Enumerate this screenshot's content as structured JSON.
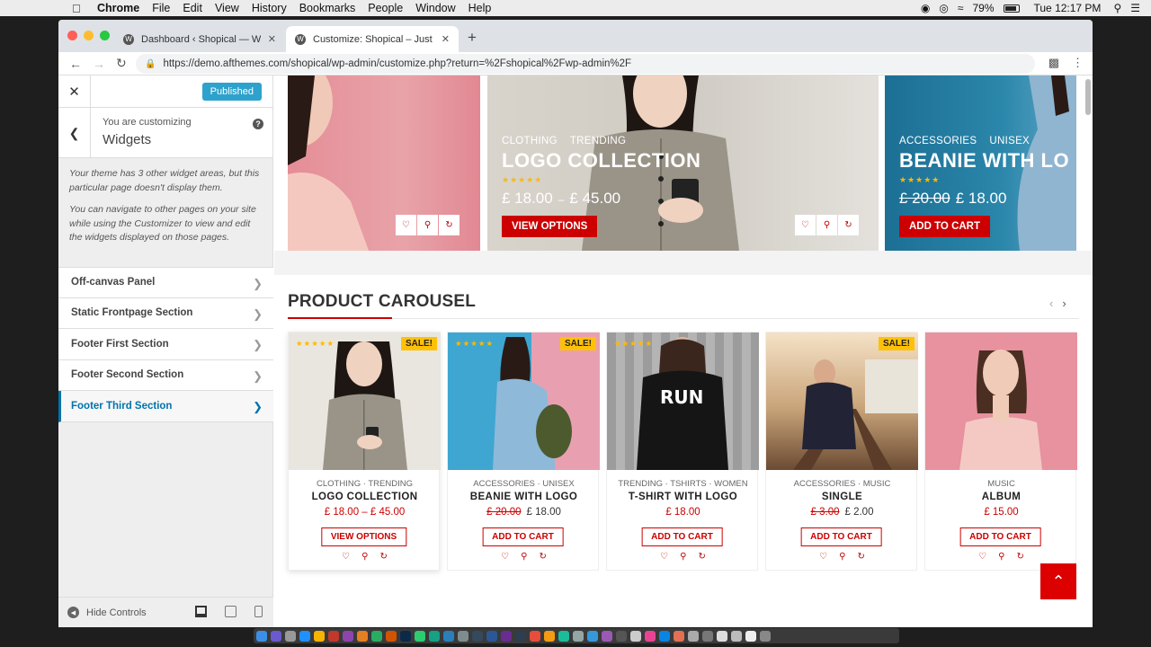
{
  "menubar": {
    "app": "Chrome",
    "items": [
      "File",
      "Edit",
      "View",
      "History",
      "Bookmarks",
      "People",
      "Window",
      "Help"
    ],
    "battery": "79%",
    "clock": "Tue 12:17 PM"
  },
  "browser": {
    "tabs": [
      {
        "title": "Dashboard ‹ Shopical — Wordi"
      },
      {
        "title": "Customize: Shopical – Just anc"
      }
    ],
    "url": "https://demo.afthemes.com/shopical/wp-admin/customize.php?return=%2Fshopical%2Fwp-admin%2F"
  },
  "panel": {
    "publish_label": "Published",
    "customizing_label": "You are customizing",
    "section_title": "Widgets",
    "notice_1": "Your theme has 3 other widget areas, but this particular page doesn't display them.",
    "notice_2": "You can navigate to other pages on your site while using the Customizer to view and edit the widgets displayed on those pages.",
    "sections": [
      {
        "label": "Off-canvas Panel"
      },
      {
        "label": "Static Frontpage Section"
      },
      {
        "label": "Footer First Section"
      },
      {
        "label": "Footer Second Section"
      },
      {
        "label": "Footer Third Section"
      }
    ],
    "hide_controls": "Hide Controls"
  },
  "hero": [
    {
      "cats": [
        "CLOTHING",
        "TRENDING"
      ],
      "title": "LOGO COLLECTION",
      "price_from": "£ 18.00",
      "price_to": "£ 45.00",
      "button": "VIEW OPTIONS"
    },
    {
      "cats": [
        "ACCESSORIES",
        "UNISEX"
      ],
      "title": "BEANIE WITH LO",
      "price_old": "£ 20.00",
      "price_new": "£ 18.00",
      "button": "ADD TO CART"
    }
  ],
  "carousel": {
    "title": "PRODUCT CAROUSEL",
    "sale_label": "SALE!",
    "products": [
      {
        "cats": "CLOTHING · TRENDING",
        "name": "LOGO COLLECTION",
        "price_a": "£ 18.00 – £ 45.00",
        "button": "VIEW OPTIONS"
      },
      {
        "cats": "ACCESSORIES · UNISEX",
        "name": "BEANIE WITH LOGO",
        "price_old": "£ 20.00",
        "price_new": "£ 18.00",
        "button": "ADD TO CART"
      },
      {
        "cats": "TRENDING · TSHIRTS · WOMEN",
        "name": "T-SHIRT WITH LOGO",
        "price_a": "£ 18.00",
        "button": "ADD TO CART",
        "img_text": "RUN"
      },
      {
        "cats": "ACCESSORIES · MUSIC",
        "name": "SINGLE",
        "price_old": "£ 3.00",
        "price_new": "£ 2.00",
        "button": "ADD TO CART"
      },
      {
        "cats": "MUSIC",
        "name": "ALBUM",
        "price_a": "£ 15.00",
        "button": "ADD TO CART"
      }
    ]
  },
  "colors": {
    "accent": "#cc0000",
    "wp_blue": "#0073aa",
    "publish": "#2ea2cc",
    "sale": "#ffc107"
  }
}
